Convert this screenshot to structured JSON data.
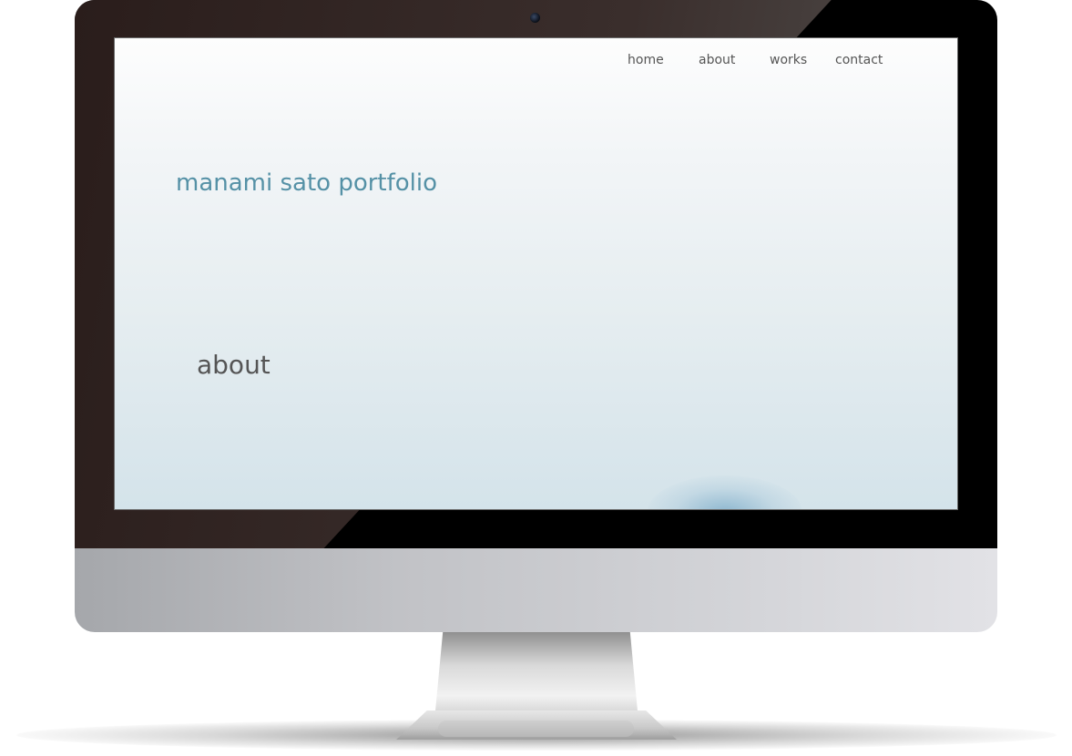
{
  "nav": {
    "items": [
      {
        "label": "home"
      },
      {
        "label": "about"
      },
      {
        "label": "works"
      },
      {
        "label": "contact"
      }
    ]
  },
  "hero": {
    "title": "manami sato portfolio"
  },
  "section": {
    "heading": "about"
  },
  "colors": {
    "title_accent": "#5591a6",
    "text": "#555555",
    "bezel": "#000000"
  }
}
